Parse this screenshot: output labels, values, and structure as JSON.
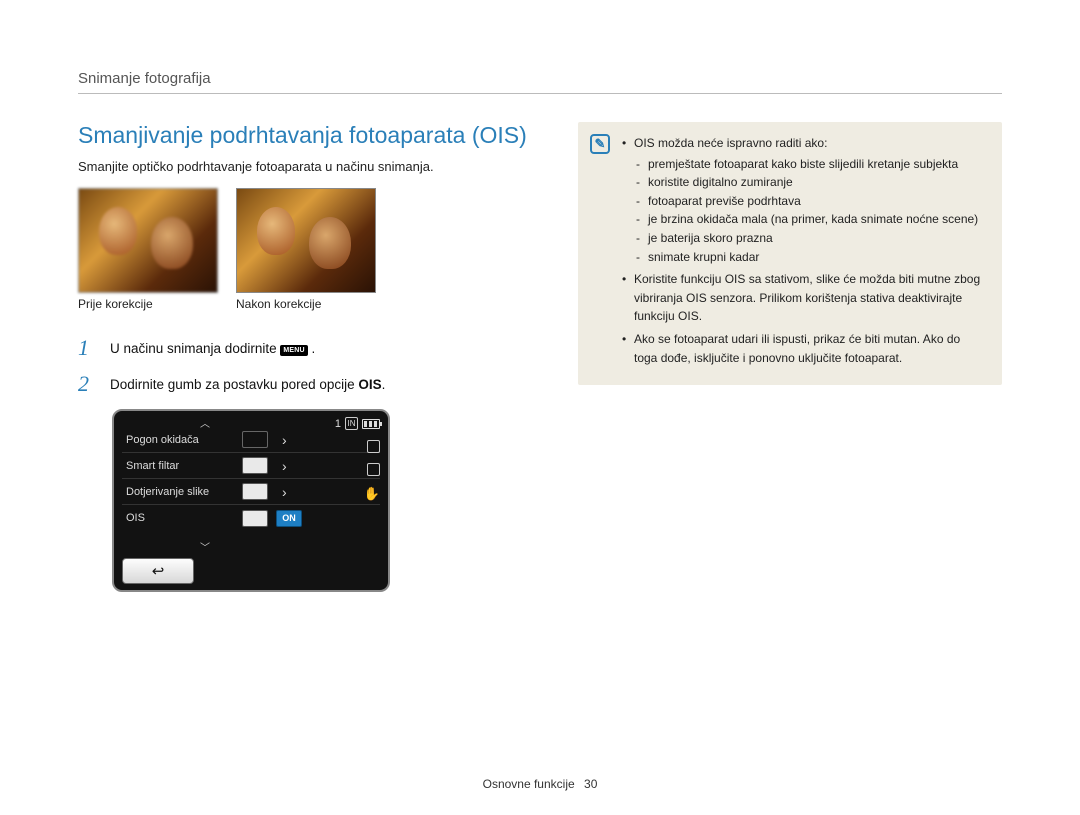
{
  "breadcrumb": "Snimanje fotografija",
  "title": "Smanjivanje podrhtavanja fotoaparata (OIS)",
  "intro": "Smanjite optičko podrhtavanje fotoaparata u načinu snimanja.",
  "photos": {
    "before_label": "Prije korekcije",
    "after_label": "Nakon korekcije"
  },
  "steps": [
    {
      "num": "1",
      "text_before": "U načinu snimanja dodirnite ",
      "badge": "MENU",
      "text_after": "."
    },
    {
      "num": "2",
      "text_before": "Dodirnite gumb za postavku pored opcije ",
      "bold": "OIS",
      "text_after": "."
    }
  ],
  "camera": {
    "top_status_count": "1",
    "top_status_in": "IN",
    "rows": [
      {
        "label": "Pogon okidača",
        "value_style": "dark",
        "value_text": "",
        "chevron": true
      },
      {
        "label": "Smart filtar",
        "value_style": "light",
        "value_text": "",
        "chevron": true
      },
      {
        "label": "Dotjerivanje slike",
        "value_style": "light",
        "value_text": "",
        "chevron": true
      },
      {
        "label": "OIS",
        "value_style": "on",
        "value_text": "ON",
        "chevron": false
      }
    ],
    "back_icon": "↩"
  },
  "info": {
    "lead": "OIS možda neće ispravno raditi ako:",
    "sub": [
      "premještate fotoaparat kako biste slijedili kretanje subjekta",
      "koristite digitalno zumiranje",
      "fotoaparat previše podrhtava",
      "je brzina okidača mala (na primer, kada snimate noćne scene)",
      "je baterija skoro prazna",
      "snimate krupni kadar"
    ],
    "b2": "Koristite funkciju OIS sa stativom, slike će možda biti mutne zbog vibriranja OIS senzora. Prilikom korištenja stativa deaktivirajte funkciju OIS.",
    "b3": "Ako se fotoaparat udari ili ispusti, prikaz će biti mutan. Ako do toga dođe, isključite i ponovno uključite fotoaparat."
  },
  "footer": {
    "section": "Osnovne funkcije",
    "page": "30"
  }
}
